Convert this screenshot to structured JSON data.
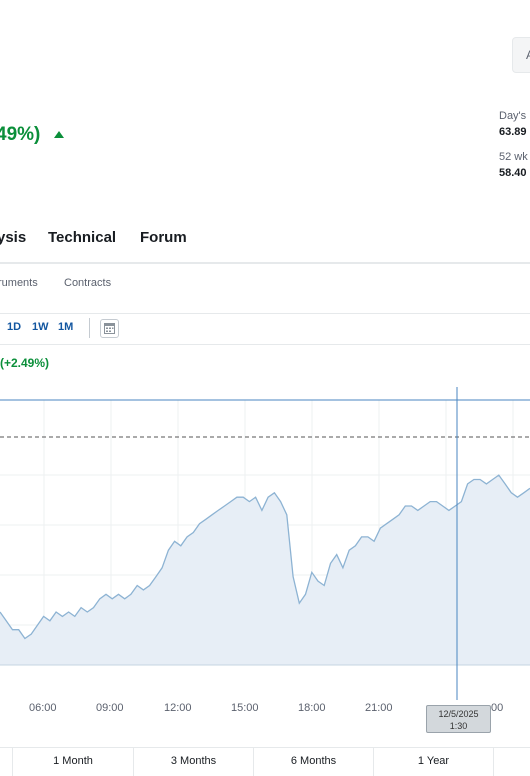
{
  "header": {
    "top_button_label": "A",
    "change_text": "49%)",
    "day_range_label": "Day's",
    "day_range_value": "63.89",
    "week52_label": "52 wk",
    "week52_value": "58.40"
  },
  "tabs": [
    "ysis",
    "Technical",
    "Forum"
  ],
  "subnav": [
    "ruments",
    "Contracts"
  ],
  "toolbar": {
    "timeframes": [
      "1D",
      "1W",
      "1M"
    ],
    "calendar_icon": "calendar-icon"
  },
  "chart": {
    "change_text": "(+2.49%)",
    "x_labels": [
      "06:00",
      "09:00",
      "12:00",
      "15:00",
      "18:00",
      "21:00",
      "00"
    ],
    "tooltip_date": "12/5/2025",
    "tooltip_time": "1:30",
    "colors": {
      "line": "#8db3d3",
      "fill": "#e7eef6",
      "crosshair": "#4a86c0",
      "up": "#0b8f3a"
    }
  },
  "chart_data": {
    "type": "area",
    "title": "",
    "xlabel": "",
    "ylabel": "",
    "x_ticks": [
      "06:00",
      "09:00",
      "12:00",
      "15:00",
      "18:00",
      "21:00",
      "00"
    ],
    "series": [
      {
        "values": [
          52,
          50,
          48,
          48,
          46,
          47,
          49,
          51,
          50,
          52,
          51,
          52,
          51,
          53,
          52,
          53,
          55,
          56,
          55,
          56,
          55,
          56,
          58,
          57,
          58,
          60,
          62,
          66,
          68,
          67,
          69,
          70,
          72,
          73,
          74,
          75,
          76,
          77,
          78,
          78,
          77,
          78,
          75,
          78,
          79,
          77,
          74,
          60,
          54,
          56,
          61,
          59,
          58,
          63,
          65,
          62,
          66,
          67,
          69,
          69,
          68,
          71,
          72,
          73,
          74,
          76,
          76,
          75,
          76,
          77,
          77,
          76,
          75,
          76,
          77,
          81,
          82,
          82,
          81,
          82,
          83,
          81,
          79,
          78,
          79,
          80
        ]
      }
    ]
  },
  "range_buttons": [
    "1 Month",
    "3 Months",
    "6 Months",
    "1 Year"
  ]
}
